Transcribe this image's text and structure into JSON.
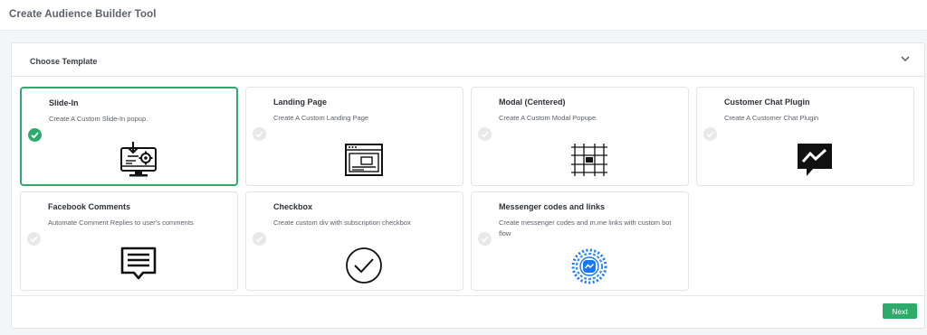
{
  "header": {
    "title": "Create Audience Builder Tool"
  },
  "panel": {
    "title": "Choose Template",
    "toggle_icon": "chevron-down-icon"
  },
  "templates": [
    {
      "title": "Slide-In",
      "description": "Create A Custom Slide-In popup.",
      "icon": "monitor-download-gear-icon",
      "selected": true
    },
    {
      "title": "Landing Page",
      "description": "Create A Custom Landing Page",
      "icon": "browser-window-icon",
      "selected": false
    },
    {
      "title": "Modal (Centered)",
      "description": "Create A Custom Modal Popupe.",
      "icon": "grid-center-icon",
      "selected": false
    },
    {
      "title": "Customer Chat Plugin",
      "description": "Create A Customer Chat Plugin",
      "icon": "chat-bubble-icon",
      "selected": false
    },
    {
      "title": "Facebook Comments",
      "description": "Automate Comment Replies to user's comments",
      "icon": "comment-lines-icon",
      "selected": false
    },
    {
      "title": "Checkbox",
      "description": "Create custom div with subscription checkbox",
      "icon": "checkmark-circle-icon",
      "selected": false
    },
    {
      "title": "Messenger codes and links",
      "description": "Create messenger codes and m.me links with custom bot flow",
      "icon": "messenger-code-icon",
      "selected": false
    }
  ],
  "footer": {
    "next_label": "Next"
  },
  "colors": {
    "accent": "#2eab6b",
    "border": "#e2e4e8",
    "check_off": "#e7e8ea"
  }
}
